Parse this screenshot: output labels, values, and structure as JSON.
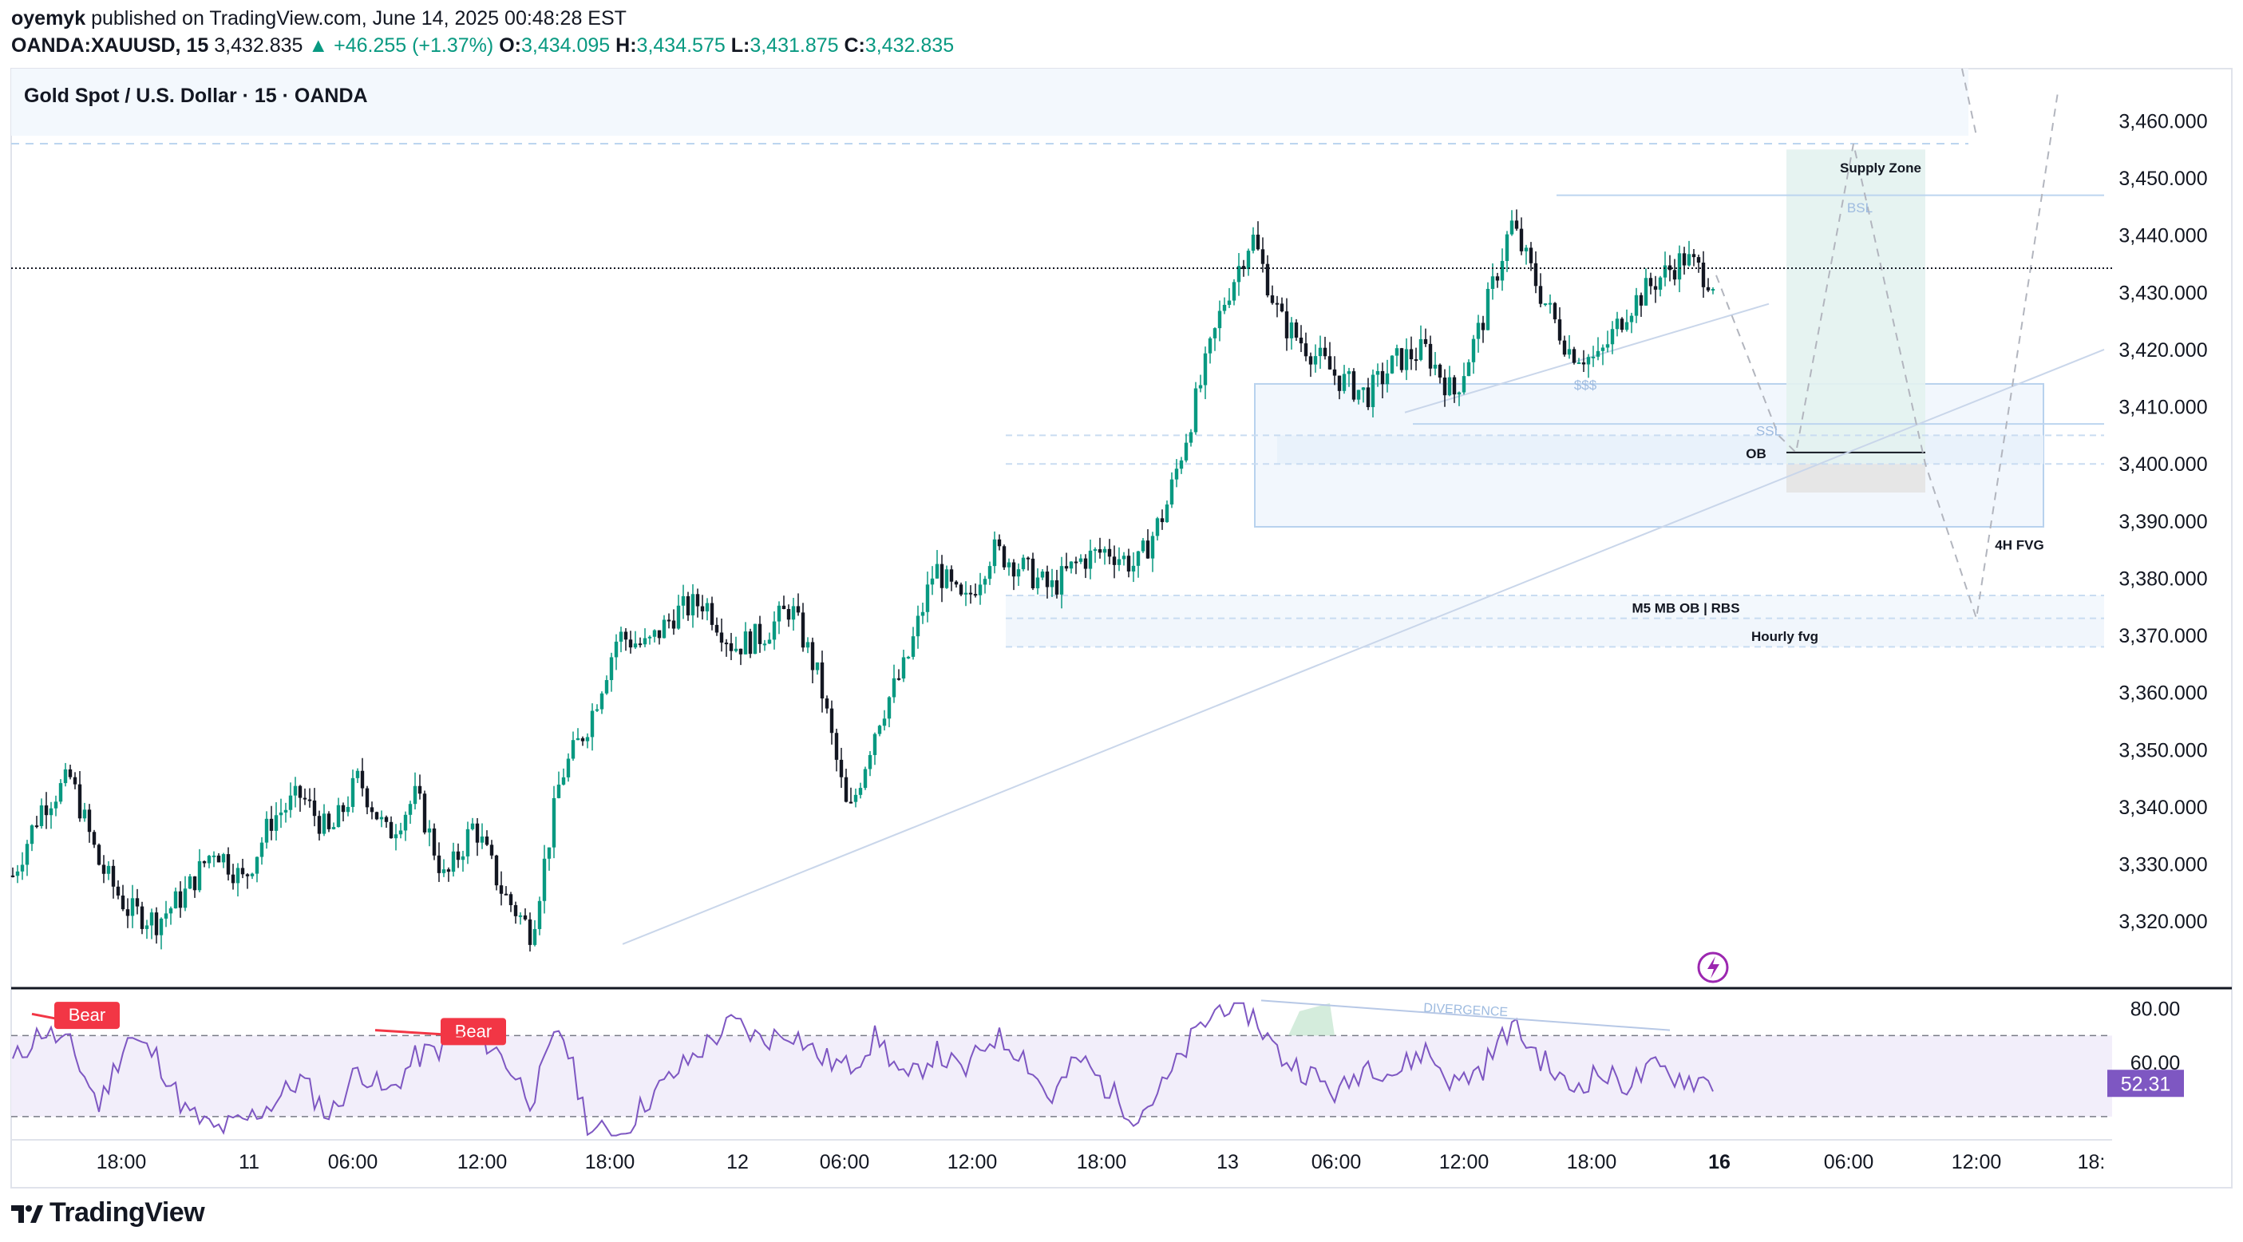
{
  "header": {
    "publisher": "oyemyk",
    "published_text": "published on TradingView.com, June 14, 2025 00:48:28 EST",
    "symbol": "OANDA:XAUUSD, 15",
    "last_price": "3,432.835",
    "change": "+46.255 (+1.37%)",
    "open_label": "O:",
    "open": "3,434.095",
    "high_label": "H:",
    "high": "3,434.575",
    "low_label": "L:",
    "low": "3,431.875",
    "close_label": "C:",
    "close": "3,432.835"
  },
  "chart_title": "Gold Spot / U.S. Dollar · 15 · OANDA",
  "footer_brand": "TradingView",
  "colors": {
    "up": "#089981",
    "down": "#131722",
    "rsi_line": "#7e57c2",
    "rsi_band": "#f2eefa",
    "bear": "#f23645",
    "zone_fill": "#e8f1fb",
    "supply_fill": "#e3f2ef",
    "ob_grey": "#e6e6e6"
  },
  "chart_data": [
    {
      "type": "candlestick",
      "title": "Gold Spot / U.S. Dollar · 15 · OANDA",
      "y_axis": {
        "ticks": [
          "3,460.000",
          "3,450.000",
          "3,440.000",
          "3,430.000",
          "3,420.000",
          "3,410.000",
          "3,400.000",
          "3,390.000",
          "3,380.000",
          "3,370.000",
          "3,360.000",
          "3,350.000",
          "3,340.000",
          "3,330.000",
          "3,320.000"
        ],
        "ylim": [
          3315,
          3463
        ]
      },
      "x_axis": {
        "ticks": [
          "18:00",
          "11",
          "06:00",
          "12:00",
          "18:00",
          "12",
          "06:00",
          "12:00",
          "18:00",
          "13",
          "06:00",
          "12:00",
          "18:00",
          "16",
          "06:00",
          "12:00",
          "18:"
        ]
      },
      "approx_price_path": [
        3328,
        3340,
        3345,
        3330,
        3322,
        3320,
        3325,
        3333,
        3327,
        3338,
        3342,
        3335,
        3345,
        3335,
        3342,
        3327,
        3337,
        3325,
        3318,
        3345,
        3355,
        3370,
        3368,
        3374,
        3376,
        3368,
        3370,
        3375,
        3362,
        3338,
        3355,
        3365,
        3382,
        3375,
        3385,
        3382,
        3378,
        3383,
        3385,
        3382,
        3392,
        3410,
        3428,
        3440,
        3425,
        3420,
        3415,
        3412,
        3418,
        3420,
        3412,
        3425,
        3442,
        3430,
        3420,
        3418,
        3427,
        3432,
        3436,
        3432
      ],
      "last_price": 3432.835,
      "annotations": {
        "texts": [
          "Supply Zone",
          "BSL",
          "$$$",
          "SSL",
          "OB",
          "4H FVG",
          "M5 MB OB | RBS",
          "Hourly fvg"
        ],
        "supply_zone": [
          3400,
          3455
        ],
        "ob_zone": [
          3395,
          3402
        ],
        "fvg_4h": [
          3389,
          3414
        ],
        "m5_ob_rbs": [
          3373,
          3377
        ],
        "hourly_fvg": [
          3368,
          3373
        ],
        "bsl_level": 3447,
        "ssl_level": 3407
      }
    },
    {
      "type": "line",
      "name": "RSI",
      "y_axis": {
        "ticks": [
          "80.00",
          "60.00"
        ],
        "ylim": [
          32,
          84
        ]
      },
      "band": [
        40,
        70
      ],
      "current_value": "52.31",
      "labels": [
        "Bear",
        "Bear",
        "DIVERGENCE"
      ],
      "approx_values": [
        60,
        72,
        66,
        44,
        70,
        62,
        42,
        35,
        38,
        45,
        54,
        40,
        58,
        48,
        62,
        66,
        72,
        62,
        46,
        74,
        36,
        32,
        46,
        56,
        66,
        75,
        68,
        72,
        62,
        58,
        70,
        52,
        64,
        56,
        70,
        64,
        46,
        62,
        50,
        40,
        52,
        70,
        82,
        78,
        62,
        56,
        48,
        60,
        56,
        65,
        52,
        58,
        74,
        62,
        50,
        56,
        52,
        58,
        54,
        53
      ]
    }
  ]
}
